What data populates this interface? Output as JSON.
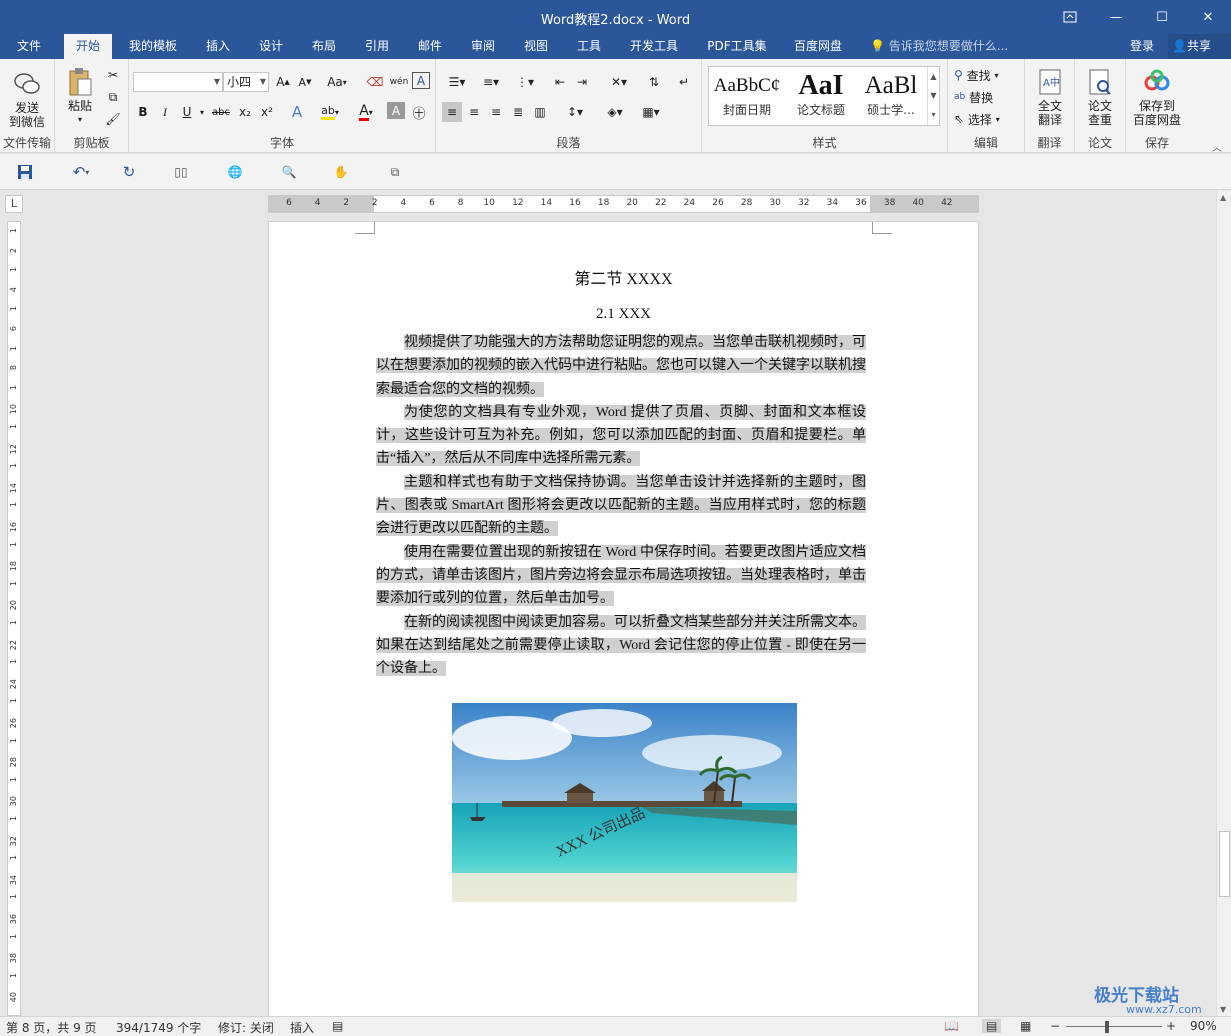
{
  "window": {
    "title": "Word教程2.docx - Word",
    "restore_icon": "ribbon-display-icon",
    "minimize_label": "—",
    "maximize_label": "☐",
    "close_label": "✕"
  },
  "tabs": [
    "文件",
    "开始",
    "我的模板",
    "插入",
    "设计",
    "布局",
    "引用",
    "邮件",
    "审阅",
    "视图",
    "工具",
    "开发工具",
    "PDF工具集",
    "百度网盘"
  ],
  "active_tab": "开始",
  "tell_me": "告诉我您想要做什么...",
  "login": "登录",
  "share": "共享",
  "ribbon": {
    "wechat": {
      "label_line1": "发送",
      "label_line2": "到微信",
      "group": "文件传输"
    },
    "clipboard": {
      "paste": "粘贴",
      "group": "剪贴板"
    },
    "font": {
      "name_value": "",
      "size_value": "小四",
      "case_label": "Aa",
      "group": "字体",
      "bold": "B",
      "italic": "I",
      "underline": "U",
      "strike": "abc",
      "sub": "x₂",
      "sup": "x²",
      "wen": "wén",
      "A_box": "A"
    },
    "paragraph": {
      "group": "段落"
    },
    "styles": {
      "group": "样式",
      "items": [
        {
          "preview": "AaBbC¢",
          "name": "封面日期"
        },
        {
          "preview": "AaI",
          "name": "论文标题"
        },
        {
          "preview": "AaBl",
          "name": "硕士学..."
        }
      ]
    },
    "editing": {
      "find": "查找",
      "replace": "替换",
      "select": "选择",
      "group": "编辑"
    },
    "translate": {
      "label_line1": "全文",
      "label_line2": "翻译",
      "group": "翻译"
    },
    "thesis": {
      "label_line1": "论文",
      "label_line2": "查重",
      "group": "论文"
    },
    "save": {
      "label_line1": "保存到",
      "label_line2": "百度网盘",
      "group": "保存"
    }
  },
  "ruler": {
    "h_ticks": [
      "6",
      "4",
      "2",
      "2",
      "4",
      "6",
      "8",
      "10",
      "12",
      "14",
      "16",
      "18",
      "20",
      "22",
      "24",
      "26",
      "28",
      "30",
      "32",
      "34",
      "36",
      "38",
      "40",
      "42"
    ],
    "v_ticks": [
      "1",
      "2",
      "1",
      "4",
      "1",
      "6",
      "1",
      "8",
      "1",
      "10",
      "1",
      "12",
      "1",
      "14",
      "1",
      "16",
      "1",
      "18",
      "1",
      "20",
      "1",
      "22",
      "1",
      "24",
      "1",
      "26",
      "1",
      "28",
      "1",
      "30",
      "1",
      "32",
      "1",
      "34",
      "1",
      "36",
      "1",
      "38",
      "1",
      "40"
    ],
    "corner": "L"
  },
  "document": {
    "heading": "第二节  XXXX",
    "subheading": "2.1 XXX",
    "paragraphs": [
      "视频提供了功能强大的方法帮助您证明您的观点。当您单击联机视频时，可以在想要添加的视频的嵌入代码中进行粘贴。您也可以键入一个关键字以联机搜索最适合您的文档的视频。",
      "为使您的文档具有专业外观，Word 提供了页眉、页脚、封面和文本框设计，这些设计可互为补充。例如，您可以添加匹配的封面、页眉和提要栏。单击“插入”，然后从不同库中选择所需元素。",
      "主题和样式也有助于文档保持协调。当您单击设计并选择新的主题时，图片、图表或 SmartArt 图形将会更改以匹配新的主题。当应用样式时，您的标题会进行更改以匹配新的主题。",
      "使用在需要位置出现的新按钮在 Word 中保存时间。若要更改图片适应文档的方式，请单击该图片，图片旁边将会显示布局选项按钮。当处理表格时，单击要添加行或列的位置，然后单击加号。",
      "在新的阅读视图中阅读更加容易。可以折叠文档某些部分并关注所需文本。如果在达到结尾处之前需要停止读取，Word 会记住您的停止位置 - 即使在另一个设备上。"
    ],
    "image_watermark": "XXX 公司出品"
  },
  "status": {
    "page": "第 8 页，共 9 页",
    "words": "394/1749 个字",
    "track": "修订: 关闭",
    "mode": "插入",
    "zoom": "90%",
    "watermark_site": "极光下载站",
    "watermark_url": "www.xz7.com"
  }
}
